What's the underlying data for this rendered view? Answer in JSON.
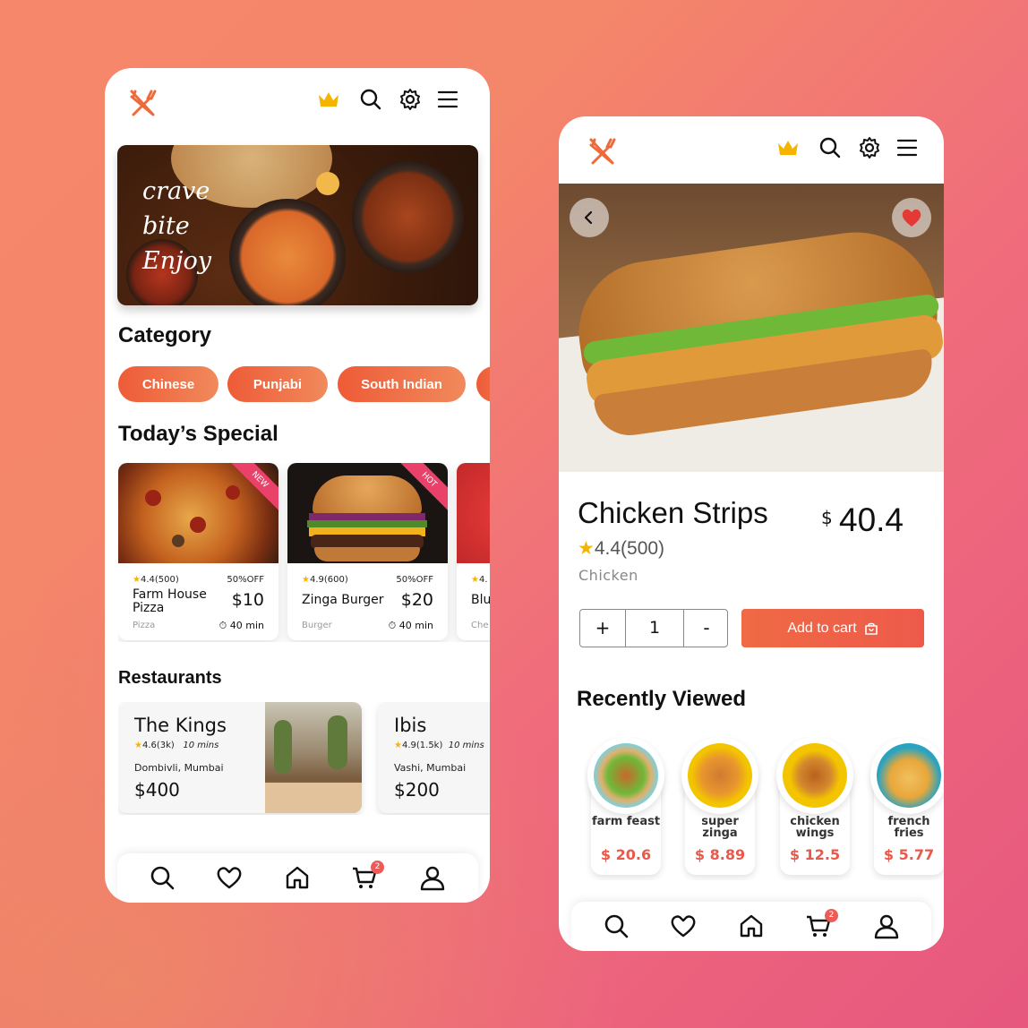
{
  "screen1": {
    "banner": {
      "line1": "crave",
      "line2": "bite",
      "line3": "Enjoy"
    },
    "category_title": "Category",
    "categories": [
      "Chinese",
      "Punjabi",
      "South Indian"
    ],
    "special_title": "Today’s Special",
    "specials": [
      {
        "ribbon": "NEW",
        "rating": "4.4(500)",
        "offer": "50%OFF",
        "name": "Farm House Pizza",
        "price": "$10",
        "category": "Pizza",
        "time": "40 min"
      },
      {
        "ribbon": "HOT",
        "rating": "4.9(600)",
        "offer": "50%OFF",
        "name": "Zinga Burger",
        "price": "$20",
        "category": "Burger",
        "time": "40 min"
      },
      {
        "ribbon": "",
        "rating": "4.",
        "offer": "",
        "name": "Blu",
        "price": "",
        "category": "Che",
        "time": ""
      }
    ],
    "restaurants_title": "Restaurants",
    "restaurants": [
      {
        "name": "The Kings",
        "rating": "4.6(3k)",
        "time": "10 mins",
        "location": "Dombivli, Mumbai",
        "price": "$400"
      },
      {
        "name": "Ibis",
        "rating": "4.9(1.5k)",
        "time": "10 mins",
        "location": "Vashi, Mumbai",
        "price": "$200"
      }
    ],
    "cart_badge": "2"
  },
  "screen2": {
    "product": {
      "name": "Chicken Strips",
      "currency": "$",
      "price": "40.4",
      "rating": "4.4(500)",
      "category": "Chicken"
    },
    "quantity": {
      "plus": "+",
      "value": "1",
      "minus": "-"
    },
    "add_to_cart": "Add to cart",
    "recently_title": "Recently Viewed",
    "recent": [
      {
        "name": "farm feast",
        "price": "$ 20.6"
      },
      {
        "name": "super zinga",
        "price": "$ 8.89"
      },
      {
        "name": "chicken wings",
        "price": "$ 12.5"
      },
      {
        "name": "french fries",
        "price": "$ 5.77"
      }
    ],
    "cart_badge": "2"
  },
  "colors": {
    "accent": "#ee5b37",
    "crown": "#f5b400",
    "heart": "#e53935",
    "badge": "#ee5a55"
  }
}
